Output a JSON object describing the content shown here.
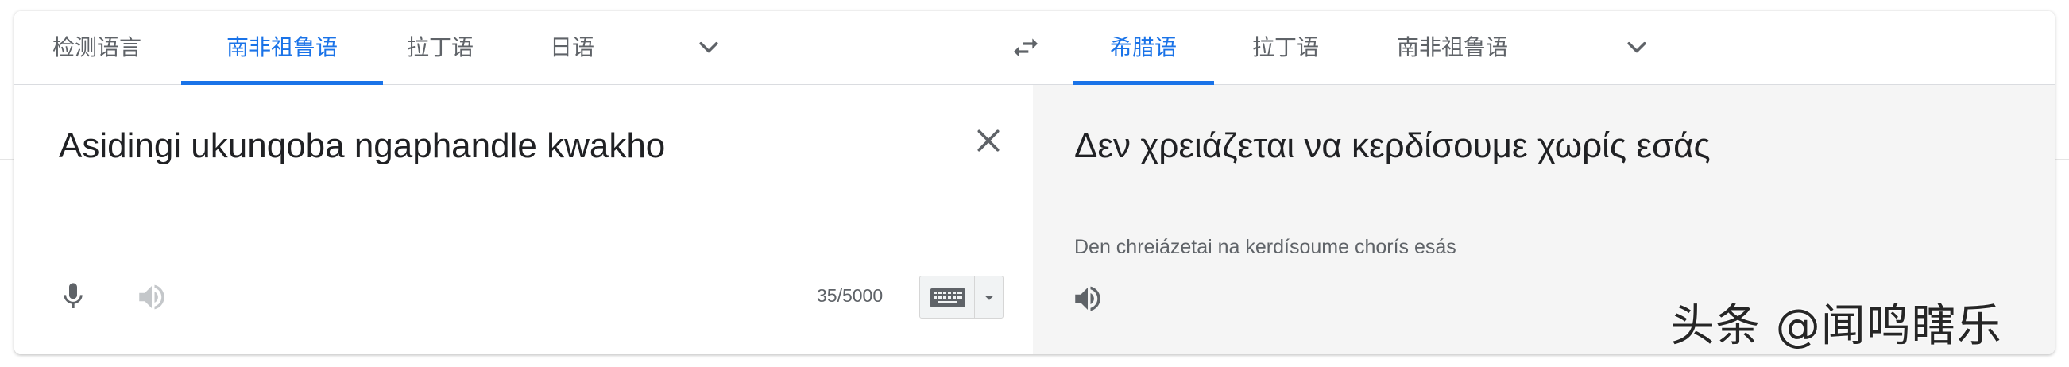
{
  "source_tabs": [
    {
      "label": "检测语言",
      "active": false
    },
    {
      "label": "南非祖鲁语",
      "active": true
    },
    {
      "label": "拉丁语",
      "active": false
    },
    {
      "label": "日语",
      "active": false
    }
  ],
  "target_tabs": [
    {
      "label": "希腊语",
      "active": true
    },
    {
      "label": "拉丁语",
      "active": false
    },
    {
      "label": "南非祖鲁语",
      "active": false
    }
  ],
  "source": {
    "text": "Asidingi ukunqoba ngaphandle kwakho",
    "char_count": "35/5000"
  },
  "target": {
    "translation": "Δεν χρειάζεται να κερδίσουμε χωρίς εσάς",
    "transliteration": "Den chreiázetai na kerdísoume chorís esás"
  },
  "watermark": "头条 @闻鸣瞎乐",
  "icons": {
    "more_source_languages": "chevron-down-icon",
    "swap_languages": "swap-icon",
    "more_target_languages": "chevron-down-icon",
    "clear": "close-icon",
    "voice_input": "microphone-icon",
    "listen_source": "speaker-icon",
    "keyboard": "keyboard-icon",
    "listen_translation": "speaker-icon"
  },
  "colors": {
    "accent": "#1a73e8",
    "tab_text": "#5f6368",
    "text": "#202124",
    "translation_bg": "#f5f5f5"
  }
}
